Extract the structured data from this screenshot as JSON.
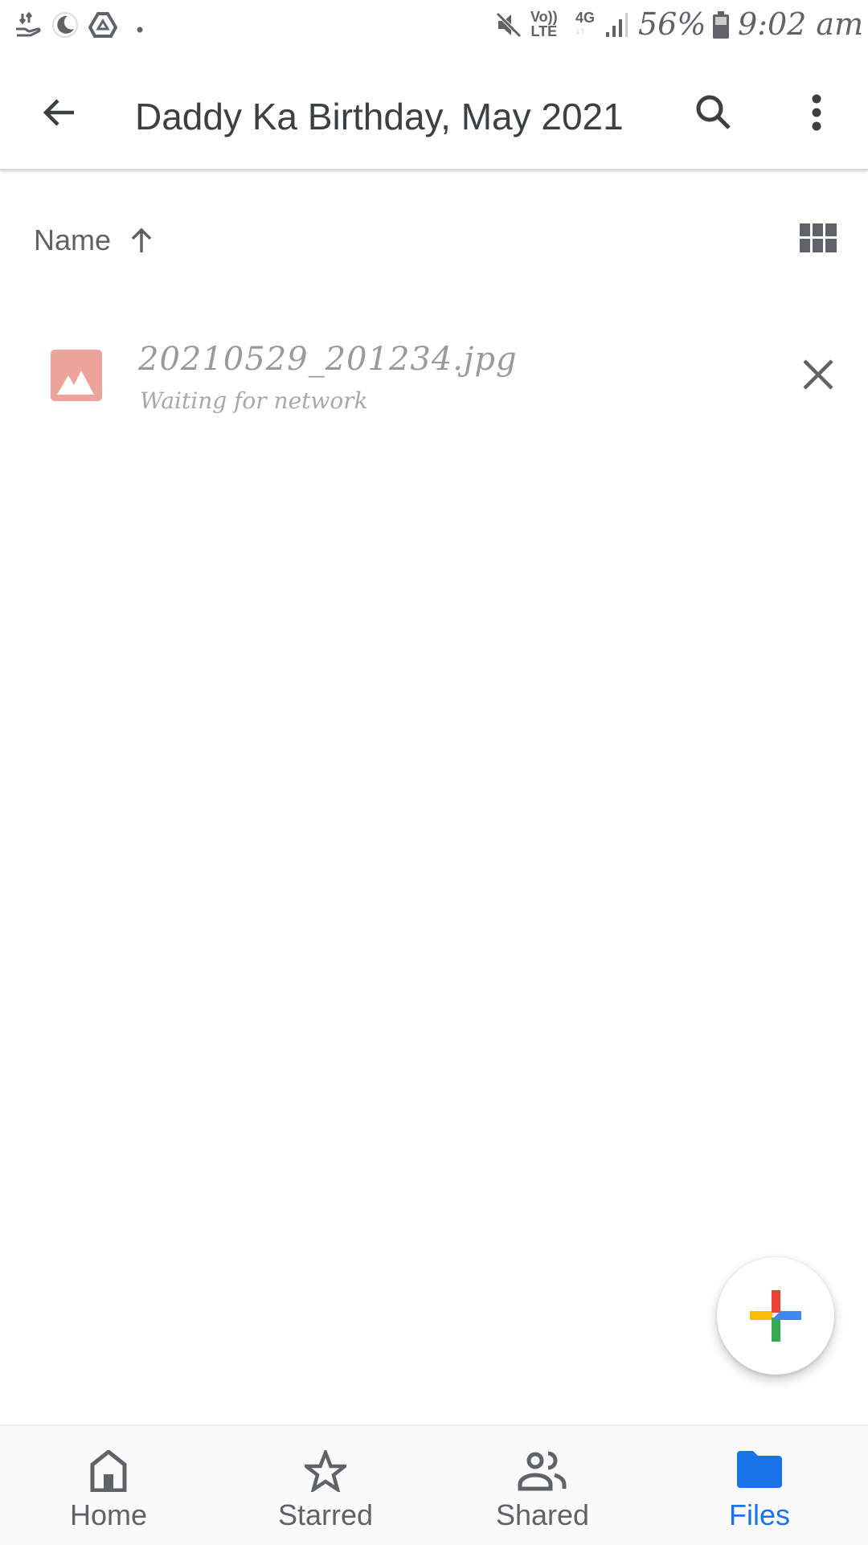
{
  "status_bar": {
    "left_icons": [
      "data-transfer-hand-icon",
      "night-mode-icon",
      "drive-icon",
      "dot-icon"
    ],
    "right_icons": [
      "mute-icon",
      "volte-icon",
      "4g-icon",
      "signal-icon",
      "battery-icon"
    ],
    "volte_line1": "Vo))",
    "volte_line2": "LTE",
    "network": "4G",
    "battery_percent": "56%",
    "time": "9:02 am"
  },
  "app_bar": {
    "title": "Daddy Ka Birthday, May 2021",
    "back_icon": "arrow-back-icon",
    "search_icon": "search-icon",
    "more_icon": "more-vert-icon"
  },
  "sort_bar": {
    "label": "Name",
    "direction_icon": "arrow-up-icon",
    "view_toggle_icon": "grid-view-icon"
  },
  "files": [
    {
      "name": "20210529_201234.jpg",
      "status": "Waiting for network",
      "type_icon": "image-icon",
      "action_icon": "close-icon"
    }
  ],
  "fab": {
    "icon": "plus-icon",
    "colors": [
      "#ea4335",
      "#4285f4",
      "#34a853",
      "#fbbc04"
    ]
  },
  "bottom_nav": {
    "items": [
      {
        "label": "Home",
        "icon": "home-icon",
        "active": false
      },
      {
        "label": "Starred",
        "icon": "star-icon",
        "active": false
      },
      {
        "label": "Shared",
        "icon": "people-icon",
        "active": false
      },
      {
        "label": "Files",
        "icon": "folder-icon",
        "active": true
      }
    ],
    "active_color": "#1a73e8",
    "inactive_color": "#5f6368"
  }
}
